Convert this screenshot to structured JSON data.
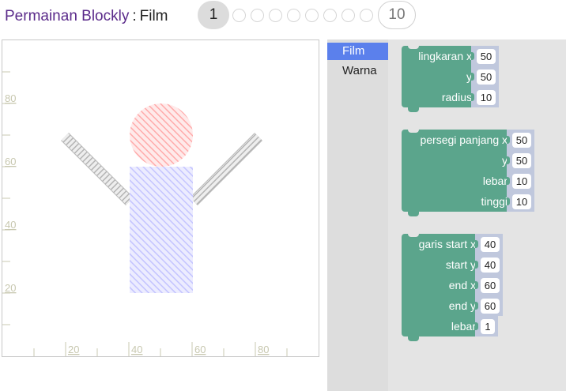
{
  "header": {
    "app_title": "Permainan Blockly",
    "separator": ":",
    "level_name": "Film",
    "current_level": "1",
    "last_level": "10",
    "dot_count": 8
  },
  "visualization": {
    "y_tick_labels": [
      "80",
      "60",
      "40",
      "20"
    ],
    "x_tick_labels": [
      "20",
      "40",
      "60",
      "80"
    ],
    "colors": {
      "head": "#ffaaaa",
      "body": "#aaaaff",
      "arms": "#aaaaaa"
    }
  },
  "toolbox": {
    "categories": [
      {
        "label": "Film",
        "selected": true
      },
      {
        "label": "Warna",
        "selected": false
      }
    ]
  },
  "blocks": [
    {
      "name": "circle-block",
      "rows": [
        {
          "label": "lingkaran x",
          "value": "50"
        },
        {
          "label": "y",
          "value": "50"
        },
        {
          "label": "radius",
          "value": "10"
        }
      ]
    },
    {
      "name": "rect-block",
      "rows": [
        {
          "label": "persegi panjang x",
          "value": "50"
        },
        {
          "label": "y",
          "value": "50"
        },
        {
          "label": "lebar",
          "value": "10"
        },
        {
          "label": "tinggi",
          "value": "10"
        }
      ]
    },
    {
      "name": "line-block",
      "rows": [
        {
          "label": "garis start x",
          "value": "40"
        },
        {
          "label": "start y",
          "value": "40"
        },
        {
          "label": "end x",
          "value": "60"
        },
        {
          "label": "end y",
          "value": "60"
        },
        {
          "label": "lebar",
          "value": "1"
        }
      ]
    }
  ]
}
